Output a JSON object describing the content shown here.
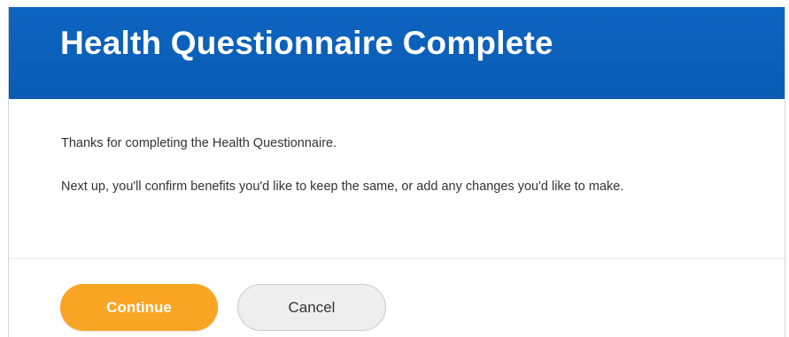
{
  "dialog": {
    "title": "Health Questionnaire Complete",
    "message_line1": "Thanks for completing the Health Questionnaire.",
    "message_line2": "Next up, you'll confirm benefits you'd like to keep the same, or add any changes you'd like to make."
  },
  "actions": {
    "continue_label": "Continue",
    "cancel_label": "Cancel"
  },
  "colors": {
    "header_blue": "#0b5fb8",
    "continue_orange": "#f8a524",
    "cancel_gray": "#efefef"
  }
}
